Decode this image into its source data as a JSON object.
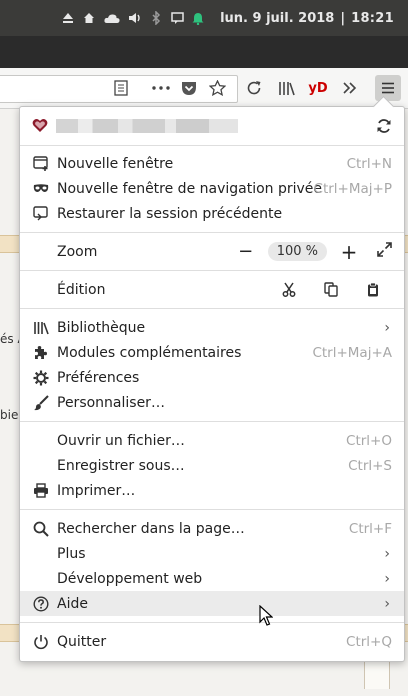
{
  "system_bar": {
    "date": "lun.  9 juil. 2018",
    "separator": "|",
    "time": "18:21",
    "icons": [
      "eject-icon",
      "home-icon",
      "cloud-icon",
      "volume-icon",
      "bluetooth-icon",
      "message-icon",
      "notification-bell-icon"
    ]
  },
  "navbar": {
    "icons": [
      "reader-view-icon",
      "page-actions-more-icon",
      "pocket-icon",
      "bookmark-star-icon",
      "reload-icon",
      "library-icon",
      "yd-extension-icon",
      "overflow-chevron-icon",
      "hamburger-menu-icon"
    ],
    "yd_label": "yD"
  },
  "background_page": {
    "fragment_1": "és A",
    "fragment_2": "bie"
  },
  "menu": {
    "account_icon": "heart-avatar-icon",
    "sync_icon": "sync-icon",
    "new_window": {
      "label": "Nouvelle fenêtre",
      "shortcut": "Ctrl+N"
    },
    "private_window": {
      "label": "Nouvelle fenêtre de navigation privée",
      "shortcut": "Ctrl+Maj+P"
    },
    "restore_session": {
      "label": "Restaurer la session précédente"
    },
    "zoom": {
      "label": "Zoom",
      "minus": "−",
      "value": "100 %",
      "plus": "+"
    },
    "edit": {
      "label": "Édition"
    },
    "library": {
      "label": "Bibliothèque"
    },
    "addons": {
      "label": "Modules complémentaires",
      "shortcut": "Ctrl+Maj+A"
    },
    "preferences": {
      "label": "Préférences"
    },
    "customize": {
      "label": "Personnaliser…"
    },
    "open_file": {
      "label": "Ouvrir un fichier…",
      "shortcut": "Ctrl+O"
    },
    "save_as": {
      "label": "Enregistrer sous…",
      "shortcut": "Ctrl+S"
    },
    "print": {
      "label": "Imprimer…"
    },
    "find": {
      "label": "Rechercher dans la page…",
      "shortcut": "Ctrl+F"
    },
    "more": {
      "label": "Plus"
    },
    "webdev": {
      "label": "Développement web"
    },
    "help": {
      "label": "Aide"
    },
    "quit": {
      "label": "Quitter",
      "shortcut": "Ctrl+Q"
    },
    "chevron": "›"
  },
  "colors": {
    "system_bar": "#3b3b39",
    "notification_green": "#2ec27e",
    "yd_red": "#cc0000",
    "heart": "#8b1a2b"
  }
}
